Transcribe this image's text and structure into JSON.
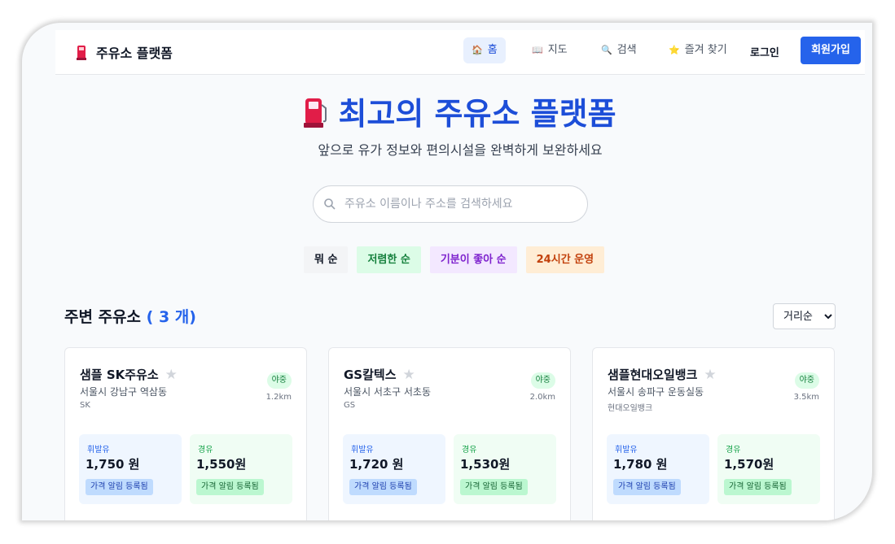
{
  "nav": {
    "brand": "주유소 플랫폼",
    "items": [
      {
        "label": "홈",
        "icon": "house-icon"
      },
      {
        "label": "지도",
        "icon": "map-icon"
      },
      {
        "label": "검색",
        "icon": "magnifier-icon"
      },
      {
        "label": "즐겨 찾기",
        "icon": "star-icon"
      }
    ],
    "login": "로그인",
    "signup": "회원가입"
  },
  "hero": {
    "title": "최고의 주유소 플랫폼",
    "subtitle": "앞으로 유가 정보와 편의시설을 완벽하게 보완하세요",
    "search_placeholder": "주유소 이름이나 주소를 검색하세요"
  },
  "filters": [
    {
      "label": "뭐 순",
      "bg": "#f3f4f6",
      "fg": "#111827"
    },
    {
      "label": "저렴한 순",
      "bg": "#dcfce7",
      "fg": "#15803d"
    },
    {
      "label": "기분이 좋아 순",
      "bg": "#f3e8ff",
      "fg": "#7e22ce"
    },
    {
      "label": "24시간 운영",
      "bg": "#ffedd5",
      "fg": "#c2410c"
    }
  ],
  "list": {
    "title": "주변 주유소",
    "count": "( 3 개)",
    "sort_value": "거리순"
  },
  "stations": [
    {
      "name": "샘플 SK주유소",
      "address": "서울시 강남구 역삼동",
      "brand": "SK",
      "badge": "야중",
      "distance": "1.2km",
      "gasoline_label": "휘발유",
      "gasoline_price": "1,750 원",
      "gasoline_tag": "가격 알림 등록됨",
      "diesel_label": "경유",
      "diesel_price": "1,550원",
      "diesel_tag": "가격 알림 등록됨"
    },
    {
      "name": "GS칼텍스",
      "address": "서울시 서초구 서초동",
      "brand": "GS",
      "badge": "야중",
      "distance": "2.0km",
      "gasoline_label": "휘발유",
      "gasoline_price": "1,720 원",
      "gasoline_tag": "가격 알림 등록됨",
      "diesel_label": "경유",
      "diesel_price": "1,530원",
      "diesel_tag": "가격 알림 등록됨"
    },
    {
      "name": "샘플현대오일뱅크",
      "address": "서울시 송파구 운동실동",
      "brand": "현대오일뱅크",
      "badge": "야중",
      "distance": "3.5km",
      "gasoline_label": "휘발유",
      "gasoline_price": "1,780 원",
      "gasoline_tag": "가격 알림 등록됨",
      "diesel_label": "경유",
      "diesel_price": "1,570원",
      "diesel_tag": "가격 알림 등록됨"
    }
  ],
  "colors": {
    "accent": "#2563eb",
    "title": "#1d4ed8"
  }
}
